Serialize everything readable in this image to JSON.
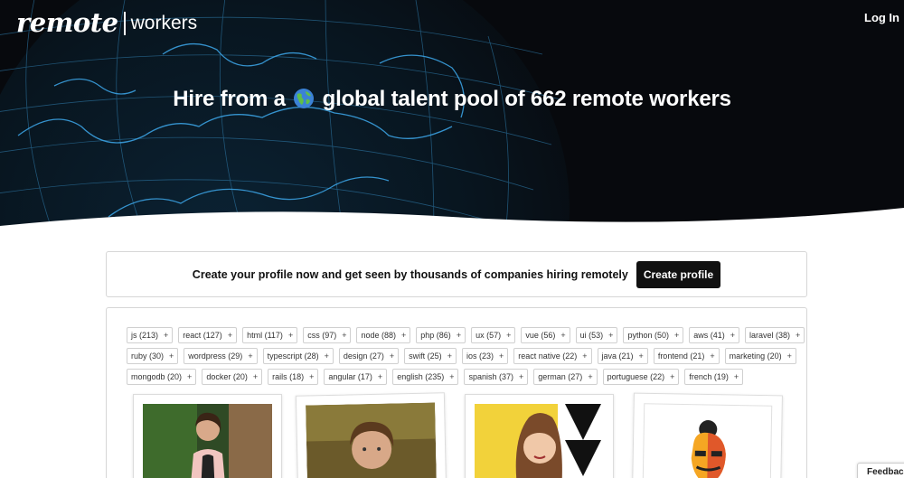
{
  "header": {
    "brand": "remote",
    "brand_suffix": "workers",
    "login_label": "Log In"
  },
  "hero": {
    "title_before": "Hire from a",
    "title_after": "global talent pool of 662 remote workers"
  },
  "cta": {
    "text": "Create your profile now and get seen by thousands of companies hiring remotely",
    "button_label": "Create profile"
  },
  "tags": [
    [
      "js (213)",
      "react (127)",
      "html (117)",
      "css (97)",
      "node (88)",
      "php (86)",
      "ux (57)",
      "vue (56)",
      "ui (53)",
      "python (50)",
      "aws (41)",
      "laravel (38)"
    ],
    [
      "ruby (30)",
      "wordpress (29)",
      "typescript (28)",
      "design (27)",
      "swift (25)",
      "ios (23)",
      "react native (22)",
      "java (21)",
      "frontend (21)",
      "marketing (20)"
    ],
    [
      "mongodb (20)",
      "docker (20)",
      "rails (18)",
      "angular (17)",
      "english (235)",
      "spanish (37)",
      "german (27)",
      "portuguese (22)",
      "french (19)"
    ]
  ],
  "tag_add_symbol": "+",
  "feedback_label": "Feedback"
}
